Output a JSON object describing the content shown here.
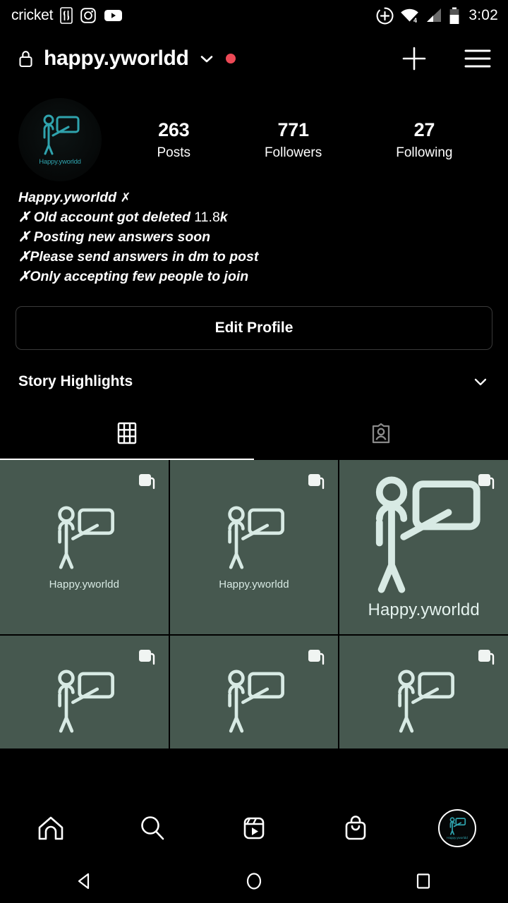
{
  "status_bar": {
    "carrier": "cricket",
    "time": "3:02",
    "icons": [
      "nba-logo-icon",
      "instagram-icon",
      "youtube-icon",
      "add-circle-icon",
      "wifi-icon",
      "cell-signal-icon",
      "battery-icon"
    ],
    "wifi_badge": "4"
  },
  "header": {
    "lock_icon": "lock-icon",
    "username": "happy.yworldd",
    "chevron": "chevron-down-icon",
    "notification_dot": true,
    "notification_dot_color": "#ed4956",
    "add_label": "add-post-icon",
    "menu_label": "hamburger-menu-icon"
  },
  "profile": {
    "avatar_label": "Happy.yworldd",
    "avatar_accent": "#2fa3ad",
    "stats": [
      {
        "number": "263",
        "label": "Posts"
      },
      {
        "number": "771",
        "label": "Followers"
      },
      {
        "number": "27",
        "label": "Following"
      }
    ]
  },
  "bio": {
    "lines": [
      {
        "text": "Happy.yworldd ",
        "emoji": "✗",
        "suffix": ""
      },
      {
        "text": "✗ Old account got deleted ",
        "plain": "11.8",
        "suffix": "k"
      },
      {
        "text": "✗ Posting new answers soon",
        "plain": "",
        "suffix": ""
      },
      {
        "text": "✗Please send answers in dm to post",
        "plain": "",
        "suffix": ""
      },
      {
        "text": "✗Only accepting few people to join",
        "plain": "",
        "suffix": ""
      }
    ]
  },
  "actions": {
    "edit_profile": "Edit Profile"
  },
  "highlights": {
    "title": "Story Highlights",
    "chevron": "chevron-down-icon"
  },
  "tabs": {
    "items": [
      {
        "name": "grid-tab",
        "icon": "grid-icon",
        "active": true
      },
      {
        "name": "tagged-tab",
        "icon": "tagged-person-icon",
        "active": false
      }
    ]
  },
  "grid": {
    "tile_bg": "#46584f",
    "icon_color": "#d8eae4",
    "tiles": [
      {
        "caption": "Happy.yworldd",
        "carousel": true,
        "big": false
      },
      {
        "caption": "Happy.yworldd",
        "carousel": true,
        "big": false
      },
      {
        "caption": "Happy.yworldd",
        "carousel": true,
        "big": true
      },
      {
        "caption": "",
        "carousel": true,
        "big": false
      },
      {
        "caption": "",
        "carousel": true,
        "big": false
      },
      {
        "caption": "",
        "carousel": true,
        "big": false
      }
    ]
  },
  "bottom_nav": {
    "items": [
      {
        "name": "nav-home",
        "icon": "home-icon",
        "active": false
      },
      {
        "name": "nav-search",
        "icon": "search-icon",
        "active": false
      },
      {
        "name": "nav-reels",
        "icon": "reels-icon",
        "active": false
      },
      {
        "name": "nav-shop",
        "icon": "shopping-bag-icon",
        "active": false
      },
      {
        "name": "nav-profile",
        "icon": "profile-avatar-icon",
        "active": true
      }
    ],
    "profile_label": "Happy.yworldd"
  },
  "android_nav": {
    "back": "back-triangle-icon",
    "home": "home-circle-icon",
    "recents": "recents-square-icon"
  }
}
